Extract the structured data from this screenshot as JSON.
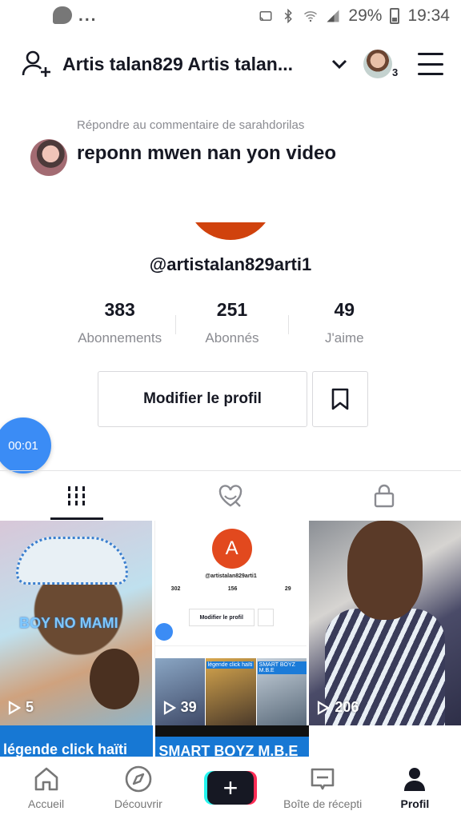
{
  "status_bar": {
    "dots": "...",
    "battery": "29%",
    "time": "19:34"
  },
  "header": {
    "title": "Artis talan829 Artis talan...",
    "avatar_count": "3"
  },
  "reply": {
    "meta": "Répondre au commentaire de sarahdorilas",
    "text": "reponn mwen nan yon video"
  },
  "profile": {
    "handle": "@artistalan829arti1",
    "stats": [
      {
        "value": "383",
        "label": "Abonnements"
      },
      {
        "value": "251",
        "label": "Abonnés"
      },
      {
        "value": "49",
        "label": "J'aime"
      }
    ],
    "edit_label": "Modifier le profil"
  },
  "floating_timer": "00:01",
  "videos": [
    {
      "views": "5",
      "watermark": "BOY NO MAMI"
    },
    {
      "views": "39",
      "mini": {
        "avatar_letter": "A",
        "handle": "@artistalan829arti1",
        "stats": [
          "302",
          "156",
          "29"
        ],
        "edit_label": "Modifier le profil",
        "overlay_1": "légende click haïti",
        "overlay_2": "SMART BOYZ M.B.E"
      }
    },
    {
      "views": "206"
    }
  ],
  "second_row": [
    {
      "caption": "légende click haïti"
    },
    {
      "caption": "SMART BOYZ M.B.E"
    }
  ],
  "nav": {
    "items": [
      "Accueil",
      "Découvrir",
      "Boîte de récepti",
      "Profil"
    ]
  }
}
